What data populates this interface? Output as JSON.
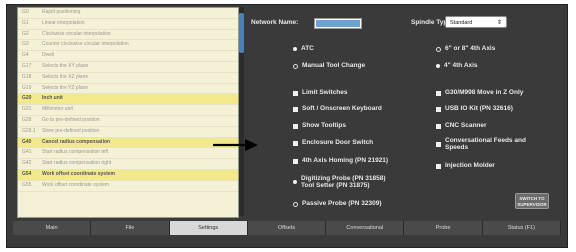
{
  "gcode_list": [
    {
      "code": "G0",
      "desc": "Rapid positioning",
      "hl": false
    },
    {
      "code": "G1",
      "desc": "Linear interpolation",
      "hl": false
    },
    {
      "code": "G2",
      "desc": "Clockwise circular interpolation",
      "hl": false
    },
    {
      "code": "G3",
      "desc": "Counter clockwise circular interpolation",
      "hl": false
    },
    {
      "code": "G4",
      "desc": "Dwell",
      "hl": false
    },
    {
      "code": "G17",
      "desc": "Selects the XY plane",
      "hl": false
    },
    {
      "code": "G18",
      "desc": "Selects the XZ plane",
      "hl": false
    },
    {
      "code": "G19",
      "desc": "Selects the YZ plane",
      "hl": false
    },
    {
      "code": "G20",
      "desc": "Inch unit",
      "hl": true
    },
    {
      "code": "G21",
      "desc": "Millimeter unit",
      "hl": false
    },
    {
      "code": "G28",
      "desc": "Go to pre-defined position",
      "hl": false
    },
    {
      "code": "G28.1",
      "desc": "Store pre-defined position",
      "hl": false
    },
    {
      "code": "G40",
      "desc": "Cancel radius compensation",
      "hl": true
    },
    {
      "code": "G41",
      "desc": "Start radius compensation left",
      "hl": false
    },
    {
      "code": "G42",
      "desc": "Start radius compensation right",
      "hl": false
    },
    {
      "code": "G54",
      "desc": "Work offset coordinate system",
      "hl": true
    },
    {
      "code": "G55",
      "desc": "Work offset coordinate system",
      "hl": false
    }
  ],
  "settings": {
    "network_name_label": "Network Name:",
    "spindle_type_label": "Spindle Type:",
    "spindle_type_value": "Standard",
    "atc": "ATC",
    "manual_tool_change": "Manual Tool Change",
    "axis_6_8": "6\" or 8\" 4th Axis",
    "axis_4": "4\" 4th Axis",
    "limit_switches": "Limit Switches",
    "soft_keyboard": "Soft / Onscreen Keyboard",
    "show_tooltips": "Show Tooltips",
    "enclosure_door_switch": "Enclosure Door Switch",
    "axis_homing": "4th Axis Homing (PN 21921)",
    "digitizing_probe_1": "Digitizing Probe (PN 31858)",
    "digitizing_probe_2": "Tool Setter (PN 31875)",
    "passive_probe": "Passive Probe (PN 32309)",
    "g30_move": "G30/M998 Move in Z Only",
    "usb_io": "USB IO Kit (PN 32616)",
    "cnc_scanner": "CNC Scanner",
    "conversational_1": "Conversational Feeds and",
    "conversational_2": "Speeds",
    "injection_molder": "Injection Molder",
    "switch_button_1": "SWITCH TO",
    "switch_button_2": "SUPERVISOR"
  },
  "tabs": [
    {
      "label": "Main",
      "active": false
    },
    {
      "label": "File",
      "active": false
    },
    {
      "label": "Settings",
      "active": true
    },
    {
      "label": "Offsets",
      "active": false
    },
    {
      "label": "Conversational",
      "active": false
    },
    {
      "label": "Probe",
      "active": false
    },
    {
      "label": "Status (F1)",
      "active": false
    }
  ],
  "colors": {
    "highlight_row": "#f2e98a",
    "list_bg": "#f4f1d6",
    "panel_bg": "#3a3a3a",
    "accent_blue": "#4a7fb8",
    "active_tab": "#d8d8d8"
  },
  "annotation": {
    "arrow_target": "enclosure_door_switch",
    "arrow_icon": "right-arrow-icon"
  }
}
